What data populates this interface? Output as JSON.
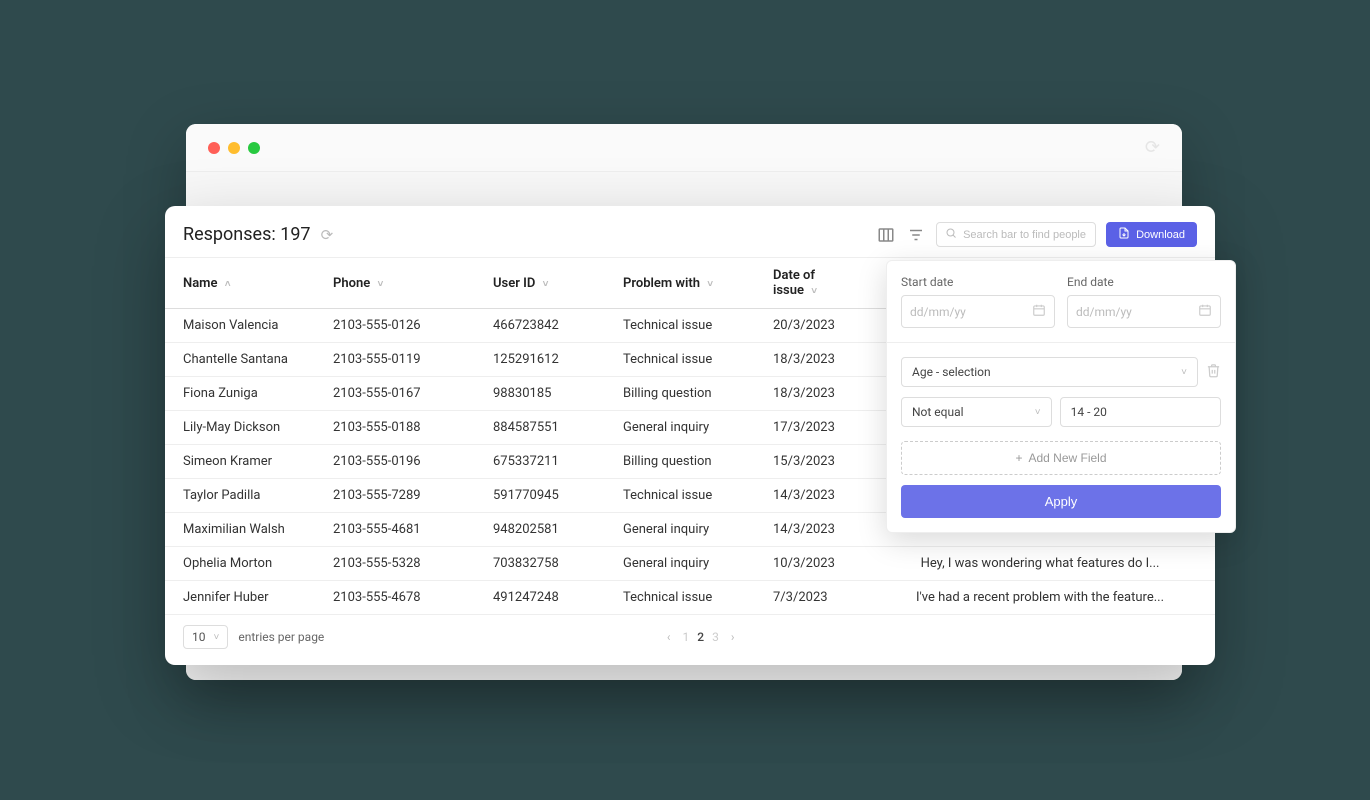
{
  "header": {
    "responsesLabel": "Responses:",
    "responsesCount": "197",
    "searchPlaceholder": "Search bar to find people",
    "downloadLabel": "Download"
  },
  "columns": {
    "name": "Name",
    "phone": "Phone",
    "userId": "User ID",
    "problem": "Problem with",
    "date": "Date of issue"
  },
  "rows": [
    {
      "name": "Maison Valencia",
      "phone": "2103-555-0126",
      "userId": "466723842",
      "problem": "Technical issue",
      "date": "20/3/2023",
      "comment": ""
    },
    {
      "name": "Chantelle Santana",
      "phone": "2103-555-0119",
      "userId": "125291612",
      "problem": "Technical issue",
      "date": "18/3/2023",
      "comment": ""
    },
    {
      "name": "Fiona Zuniga",
      "phone": "2103-555-0167",
      "userId": "98830185",
      "problem": "Billing question",
      "date": "18/3/2023",
      "comment": ""
    },
    {
      "name": "Lily-May Dickson",
      "phone": "2103-555-0188",
      "userId": "884587551",
      "problem": "General inquiry",
      "date": "17/3/2023",
      "comment": ""
    },
    {
      "name": "Simeon Kramer",
      "phone": "2103-555-0196",
      "userId": "675337211",
      "problem": "Billing question",
      "date": "15/3/2023",
      "comment": ""
    },
    {
      "name": "Taylor Padilla",
      "phone": "2103-555-7289",
      "userId": "591770945",
      "problem": "Technical issue",
      "date": "14/3/2023",
      "comment": ""
    },
    {
      "name": "Maximilian Walsh",
      "phone": "2103-555-4681",
      "userId": "948202581",
      "problem": "General inquiry",
      "date": "14/3/2023",
      "comment": ""
    },
    {
      "name": "Ophelia Morton",
      "phone": "2103-555-5328",
      "userId": "703832758",
      "problem": "General inquiry",
      "date": "10/3/2023",
      "comment": "Hey, I was wondering what features do I..."
    },
    {
      "name": "Jennifer Huber",
      "phone": "2103-555-4678",
      "userId": "491247248",
      "problem": "Technical issue",
      "date": "7/3/2023",
      "comment": "I've had a recent problem with the feature..."
    }
  ],
  "footer": {
    "entriesValue": "10",
    "entriesLabel": "entries per page",
    "pages": [
      "1",
      "2",
      "3"
    ],
    "activePage": 1
  },
  "filter": {
    "startDateLabel": "Start date",
    "endDateLabel": "End date",
    "datePlaceholder": "dd/mm/yy",
    "fieldSelect": "Age - selection",
    "operator": "Not equal",
    "value": "14 - 20",
    "addFieldLabel": "Add New Field",
    "applyLabel": "Apply"
  }
}
